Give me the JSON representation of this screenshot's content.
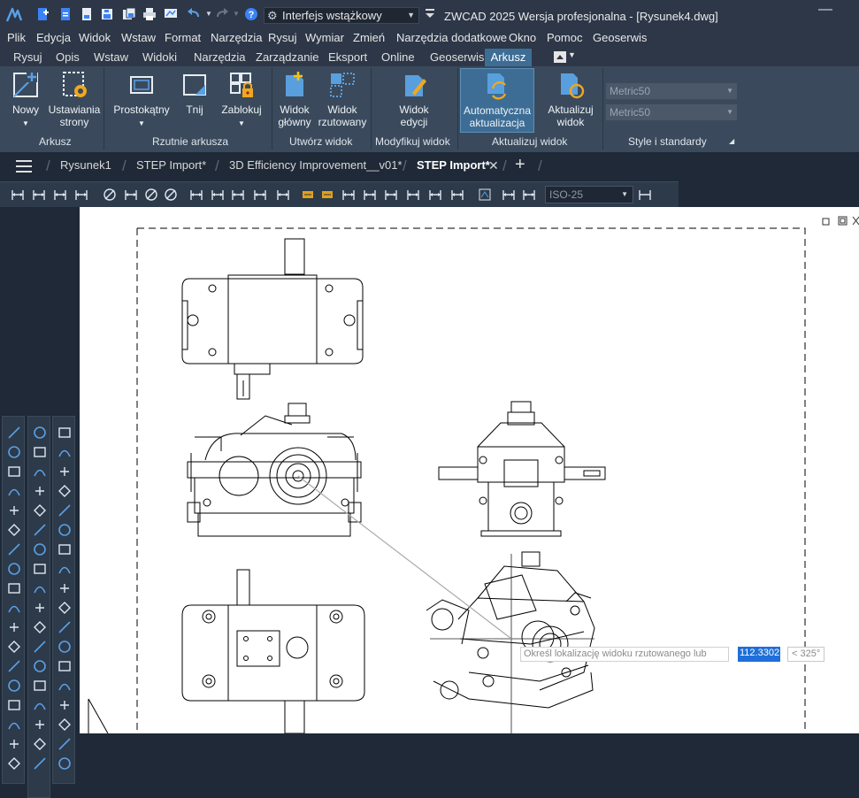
{
  "workspace": {
    "label": "Interfejs wstążkowy"
  },
  "window": {
    "title": "ZWCAD 2025 Wersja profesjonalna - [Rysunek4.dwg]"
  },
  "menu": [
    "Plik",
    "Edycja",
    "Widok",
    "Wstaw",
    "Format",
    "Narzędzia",
    "Rysuj",
    "Wymiar",
    "Zmień",
    "Narzędzia dodatkowe",
    "Okno",
    "Pomoc",
    "Geoserwis"
  ],
  "ribbon_tabs": [
    "Rysuj",
    "Opis",
    "Wstaw",
    "Widoki",
    "Narzędzia",
    "Zarządzanie",
    "Eksport",
    "Online",
    "Geoserwis",
    "Arkusz"
  ],
  "ribbon_active_tab": "Arkusz",
  "ribbon": {
    "nowy": "Nowy",
    "ustawiania_1": "Ustawiania",
    "ustawiania_2": "strony",
    "prostokatny": "Prostokątny",
    "tnij": "Tnij",
    "zablokuj": "Zablokuj",
    "widok_glowny_1": "Widok",
    "widok_glowny_2": "główny",
    "widok_rzutowany_1": "Widok",
    "widok_rzutowany_2": "rzutowany",
    "widok_edycji_1": "Widok",
    "widok_edycji_2": "edycji",
    "auto_1": "Automatyczna",
    "auto_2": "aktualizacja",
    "aktualizuj_1": "Aktualizuj",
    "aktualizuj_2": "widok",
    "style1": "Metric50",
    "style2": "Metric50"
  },
  "panels": [
    "Arkusz",
    "Rzutnie arkusza",
    "Utwórz widok",
    "Modyfikuj widok",
    "Aktualizuj widok",
    "Style i standardy"
  ],
  "doc_tabs": [
    "Rysunek1",
    "STEP Import*",
    "3D Efficiency Improvement__v01*",
    "STEP Import*"
  ],
  "active_doc_tab": "STEP Import*",
  "dim_style": "ISO-25",
  "prompt": {
    "text": "Określ lokalizację widoku rzutowanego lub",
    "value": "112.3302",
    "angle": "< 325°"
  }
}
